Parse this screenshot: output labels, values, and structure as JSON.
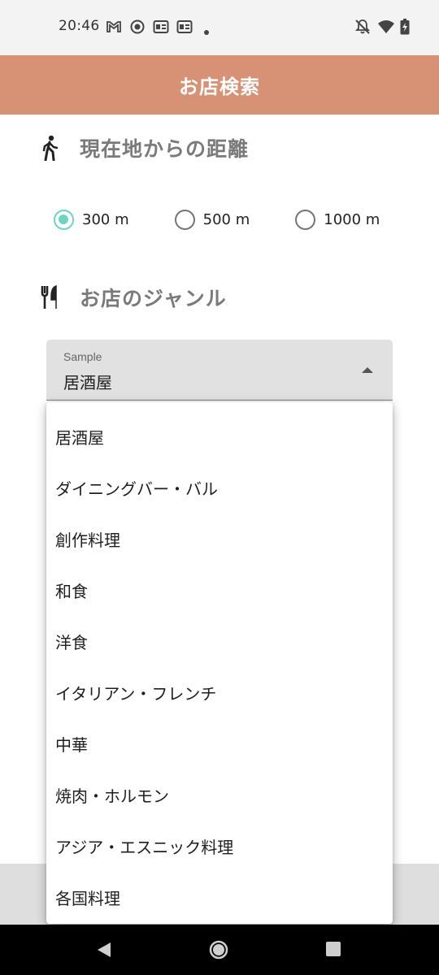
{
  "status_bar": {
    "time": "20:46",
    "left_icons": [
      "gmail-icon",
      "record-icon",
      "news-icon",
      "news-icon",
      "dot-icon"
    ],
    "right_icons": [
      "bell-off-icon",
      "wifi-icon",
      "battery-charging-icon"
    ]
  },
  "app_bar": {
    "title": "お店検索",
    "color": "#d79174"
  },
  "distance_section": {
    "title": "現在地からの距離",
    "icon": "walk-icon",
    "options": [
      {
        "label": "300 m",
        "checked": true
      },
      {
        "label": "500 m",
        "checked": false
      },
      {
        "label": "1000 m",
        "checked": false
      }
    ],
    "accent_color": "#6fd3c4"
  },
  "genre_section": {
    "title": "お店のジャンル",
    "icon": "restaurant-icon",
    "select": {
      "label": "Sample",
      "value": "居酒屋"
    },
    "menu_items": [
      "居酒屋",
      "ダイニングバー・バル",
      "創作料理",
      "和食",
      "洋食",
      "イタリアン・フレンチ",
      "中華",
      "焼肉・ホルモン",
      "アジア・エスニック料理",
      "各国料理"
    ]
  },
  "nav_bar": {
    "buttons": [
      "back-icon",
      "home-icon",
      "recents-icon"
    ]
  }
}
